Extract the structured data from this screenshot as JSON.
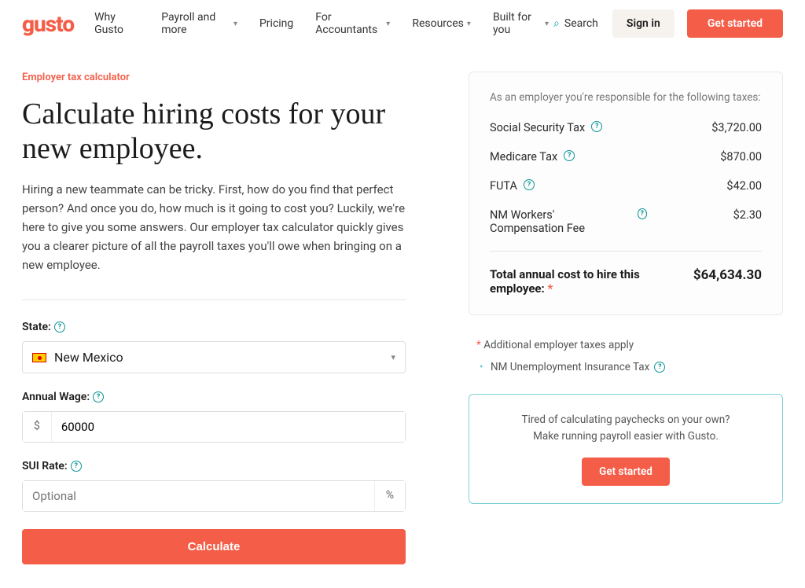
{
  "header": {
    "logo": "gusto",
    "nav": [
      {
        "label": "Why Gusto",
        "dropdown": false
      },
      {
        "label": "Payroll and more",
        "dropdown": true
      },
      {
        "label": "Pricing",
        "dropdown": false
      },
      {
        "label": "For Accountants",
        "dropdown": true
      },
      {
        "label": "Resources",
        "dropdown": true
      },
      {
        "label": "Built for you",
        "dropdown": true
      }
    ],
    "search": "Search",
    "signin": "Sign in",
    "cta": "Get started"
  },
  "left": {
    "eyebrow": "Employer tax calculator",
    "headline": "Calculate hiring costs for your new employee.",
    "intro": "Hiring a new teammate can be tricky. First, how do you find that perfect person? And once you do, how much is it going to cost you? Luckily, we're here to give you some answers. Our employer tax calculator quickly gives you a clearer picture of all the payroll taxes you'll owe when bringing on a new employee.",
    "form": {
      "state_label": "State:",
      "state_value": "New Mexico",
      "wage_label": "Annual Wage:",
      "wage_prefix": "$",
      "wage_value": "60000",
      "sui_label": "SUI Rate:",
      "sui_placeholder": "Optional",
      "sui_suffix": "%",
      "button": "Calculate"
    }
  },
  "right": {
    "heading": "As an employer you're responsible for the following taxes:",
    "taxes": [
      {
        "label": "Social Security Tax",
        "value": "$3,720.00"
      },
      {
        "label": "Medicare Tax",
        "value": "$870.00"
      },
      {
        "label": "FUTA",
        "value": "$42.00"
      },
      {
        "label": "NM Workers' Compensation Fee",
        "value": "$2.30"
      }
    ],
    "total_label": "Total annual cost to hire this employee:",
    "total_value": "$64,634.30",
    "additional_heading": "Additional employer taxes apply",
    "additional_items": [
      "NM Unemployment Insurance Tax"
    ],
    "cta_line1": "Tired of calculating paychecks on your own?",
    "cta_line2": "Make running payroll easier with Gusto.",
    "cta_button": "Get started"
  }
}
